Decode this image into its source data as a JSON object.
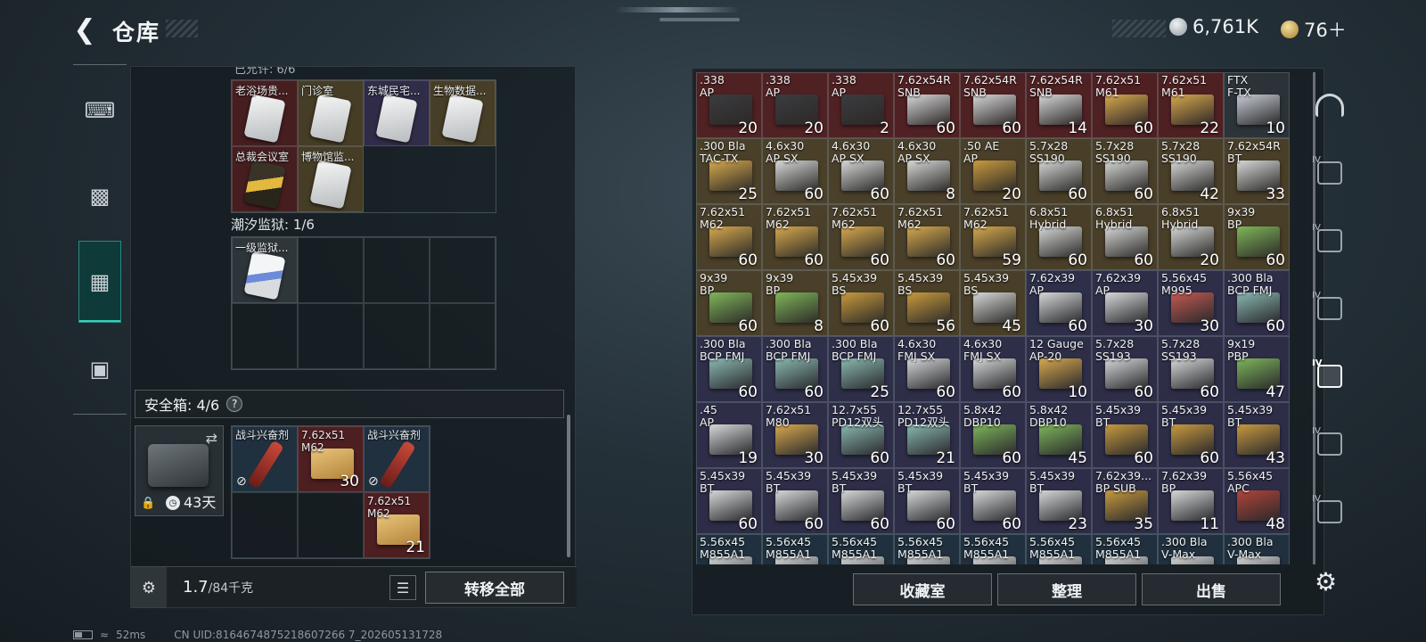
{
  "header": {
    "title": "仓库",
    "silver_amount": "6,761K",
    "gold_amount": "76＋"
  },
  "left_nav": [
    "gun-icon",
    "backpack-icon",
    "container-icon",
    "briefcase-icon"
  ],
  "keycards": {
    "cut_label": "已允许: 6/6",
    "items": [
      {
        "label": "老浴场贵...",
        "rarity": "red",
        "icon": "card-icon"
      },
      {
        "label": "门诊室",
        "rarity": "gold",
        "icon": "card-icon"
      },
      {
        "label": "东城民宅...",
        "rarity": "purple",
        "icon": "card-icon"
      },
      {
        "label": "生物数据...",
        "rarity": "gold",
        "icon": "card-icon"
      },
      {
        "label": "总裁会议室",
        "rarity": "red",
        "icon": "card-icon-gold"
      },
      {
        "label": "博物馆监...",
        "rarity": "gold",
        "icon": "card-icon"
      }
    ],
    "prison_label": "潮汐监狱: 1/6",
    "prison_items": [
      {
        "label": "一级监狱...",
        "rarity": "gray",
        "icon": "card-icon-blue"
      }
    ]
  },
  "safe_box": {
    "label": "安全箱: 4/6",
    "help": "?",
    "days": "43天",
    "items": [
      {
        "label": "战斗兴奋剂",
        "count": "",
        "type": "stim"
      },
      {
        "label": "7.62x51\nM62",
        "count": "30",
        "type": "ammo"
      },
      {
        "label": "战斗兴奋剂",
        "count": "",
        "type": "stim"
      },
      {
        "label": "7.62x51\nM62",
        "count": "21",
        "type": "ammo"
      }
    ]
  },
  "weight": {
    "current": "1.7",
    "max": "/84千克"
  },
  "buttons": {
    "transfer_all": "转移全部",
    "collection": "收藏室",
    "organize": "整理",
    "sell": "出售"
  },
  "right_nav": [
    {
      "tag": "",
      "icon": "arch-icon"
    },
    {
      "tag": "IV",
      "icon": "stash-tab-1-icon"
    },
    {
      "tag": "IV",
      "icon": "stash-tab-2-icon"
    },
    {
      "tag": "IV",
      "icon": "stash-tab-3-icon"
    },
    {
      "tag": "IV",
      "icon": "stash-tab-4-icon",
      "active": true
    },
    {
      "tag": "IV",
      "icon": "stash-tab-5-icon"
    },
    {
      "tag": "IV",
      "icon": "stash-tab-6-icon"
    }
  ],
  "stash": [
    {
      "name": ".338\nAP",
      "count": "20",
      "bg": "red",
      "box": "#3a3d3f"
    },
    {
      "name": ".338\nAP",
      "count": "20",
      "bg": "red",
      "box": "#3a3d3f"
    },
    {
      "name": ".338\nAP",
      "count": "2",
      "bg": "red",
      "box": "#3a3d3f"
    },
    {
      "name": "7.62x54R\nSNB",
      "count": "60",
      "bg": "red",
      "box": "#d6d8d8"
    },
    {
      "name": "7.62x54R\nSNB",
      "count": "60",
      "bg": "red",
      "box": "#d6d8d8"
    },
    {
      "name": "7.62x54R\nSNB",
      "count": "14",
      "bg": "red",
      "box": "#d6d8d8"
    },
    {
      "name": "7.62x51\nM61",
      "count": "60",
      "bg": "red",
      "box": "#d7a94e"
    },
    {
      "name": "7.62x51\nM61",
      "count": "22",
      "bg": "red",
      "box": "#d7a94e"
    },
    {
      "name": "FTX\nF-TX",
      "count": "10",
      "bg": "gray",
      "box": "#c9ccd6"
    },
    {
      "name": ".300 Bla\nTAC-TX",
      "count": "25",
      "bg": "gold",
      "box": "#d7a94e"
    },
    {
      "name": "4.6x30\nAP SX",
      "count": "60",
      "bg": "gold",
      "box": "#d6d8d8"
    },
    {
      "name": "4.6x30\nAP SX",
      "count": "60",
      "bg": "gold",
      "box": "#d6d8d8"
    },
    {
      "name": "4.6x30\nAP SX",
      "count": "8",
      "bg": "gold",
      "box": "#d6d8d8"
    },
    {
      "name": ".50 AE\nAP",
      "count": "20",
      "bg": "gold",
      "box": "#c89a3e"
    },
    {
      "name": "5.7x28\nSS190",
      "count": "60",
      "bg": "gold",
      "box": "#d6d8d8"
    },
    {
      "name": "5.7x28\nSS190",
      "count": "60",
      "bg": "gold",
      "box": "#d6d8d8"
    },
    {
      "name": "5.7x28\nSS190",
      "count": "42",
      "bg": "gold",
      "box": "#d6d8d8"
    },
    {
      "name": "7.62x54R\nBT",
      "count": "33",
      "bg": "gold",
      "box": "#d6d8d8"
    },
    {
      "name": "7.62x51\nM62",
      "count": "60",
      "bg": "gold",
      "box": "#d7a94e"
    },
    {
      "name": "7.62x51\nM62",
      "count": "60",
      "bg": "gold",
      "box": "#d7a94e"
    },
    {
      "name": "7.62x51\nM62",
      "count": "60",
      "bg": "gold",
      "box": "#d7a94e"
    },
    {
      "name": "7.62x51\nM62",
      "count": "60",
      "bg": "gold",
      "box": "#d7a94e"
    },
    {
      "name": "7.62x51\nM62",
      "count": "59",
      "bg": "gold",
      "box": "#d7a94e"
    },
    {
      "name": "6.8x51\nHybrid",
      "count": "60",
      "bg": "gold",
      "box": "#d6d8d8"
    },
    {
      "name": "6.8x51\nHybrid",
      "count": "60",
      "bg": "gold",
      "box": "#d6d8d8"
    },
    {
      "name": "6.8x51\nHybrid",
      "count": "20",
      "bg": "gold",
      "box": "#d6d8d8"
    },
    {
      "name": "9x39\nBP",
      "count": "60",
      "bg": "gold",
      "box": "#7fb65a"
    },
    {
      "name": "9x39\nBP",
      "count": "60",
      "bg": "gold",
      "box": "#7fb65a"
    },
    {
      "name": "9x39\nBP",
      "count": "8",
      "bg": "gold",
      "box": "#7fb65a"
    },
    {
      "name": "5.45x39\nBS",
      "count": "60",
      "bg": "gold",
      "box": "#c89a3e"
    },
    {
      "name": "5.45x39\nBS",
      "count": "56",
      "bg": "gold",
      "box": "#c89a3e"
    },
    {
      "name": "5.45x39\nBS",
      "count": "45",
      "bg": "gold",
      "box": "#d6d8d8"
    },
    {
      "name": "7.62x39\nAP",
      "count": "60",
      "bg": "purple",
      "box": "#d6d8d8"
    },
    {
      "name": "7.62x39\nAP",
      "count": "30",
      "bg": "purple",
      "box": "#d6d8d8"
    },
    {
      "name": "5.56x45\nM995",
      "count": "30",
      "bg": "purple",
      "box": "#c45a50"
    },
    {
      "name": ".300 Bla\nBCP FMJ",
      "count": "60",
      "bg": "purple",
      "box": "#8ab8b0"
    },
    {
      "name": ".300 Bla\nBCP FMJ",
      "count": "60",
      "bg": "purple",
      "box": "#8ab8b0"
    },
    {
      "name": ".300 Bla\nBCP FMJ",
      "count": "60",
      "bg": "purple",
      "box": "#8ab8b0"
    },
    {
      "name": ".300 Bla\nBCP FMJ",
      "count": "25",
      "bg": "purple",
      "box": "#8ab8b0"
    },
    {
      "name": "4.6x30\nFMJ SX",
      "count": "60",
      "bg": "purple",
      "box": "#d6d8d8"
    },
    {
      "name": "4.6x30\nFMJ SX",
      "count": "60",
      "bg": "purple",
      "box": "#d6d8d8"
    },
    {
      "name": "12 Gauge\nAP-20",
      "count": "10",
      "bg": "purple",
      "box": "#d7a94e"
    },
    {
      "name": "5.7x28\nSS193",
      "count": "60",
      "bg": "purple",
      "box": "#d6d8d8"
    },
    {
      "name": "5.7x28\nSS193",
      "count": "60",
      "bg": "purple",
      "box": "#d6d8d8"
    },
    {
      "name": "9x19\nPBP",
      "count": "47",
      "bg": "purple",
      "box": "#7fb65a"
    },
    {
      "name": ".45\nAP",
      "count": "19",
      "bg": "purple",
      "box": "#d6d8d8"
    },
    {
      "name": "7.62x51\nM80",
      "count": "30",
      "bg": "purple",
      "box": "#d7a94e"
    },
    {
      "name": "12.7x55\nPD12双头",
      "count": "60",
      "bg": "purple",
      "box": "#8ab8b0"
    },
    {
      "name": "12.7x55\nPD12双头",
      "count": "21",
      "bg": "purple",
      "box": "#8ab8b0"
    },
    {
      "name": "5.8x42\nDBP10",
      "count": "60",
      "bg": "purple",
      "box": "#7fb65a"
    },
    {
      "name": "5.8x42\nDBP10",
      "count": "45",
      "bg": "purple",
      "box": "#7fb65a"
    },
    {
      "name": "5.45x39\nBT",
      "count": "60",
      "bg": "purple",
      "box": "#c89a3e"
    },
    {
      "name": "5.45x39\nBT",
      "count": "60",
      "bg": "purple",
      "box": "#c89a3e"
    },
    {
      "name": "5.45x39\nBT",
      "count": "43",
      "bg": "purple",
      "box": "#c89a3e"
    },
    {
      "name": "5.45x39\nBT",
      "count": "60",
      "bg": "purple",
      "box": "#d6d8d8"
    },
    {
      "name": "5.45x39\nBT",
      "count": "60",
      "bg": "purple",
      "box": "#d6d8d8"
    },
    {
      "name": "5.45x39\nBT",
      "count": "60",
      "bg": "purple",
      "box": "#d6d8d8"
    },
    {
      "name": "5.45x39\nBT",
      "count": "60",
      "bg": "purple",
      "box": "#d6d8d8"
    },
    {
      "name": "5.45x39\nBT",
      "count": "60",
      "bg": "purple",
      "box": "#d6d8d8"
    },
    {
      "name": "5.45x39\nBT",
      "count": "23",
      "bg": "purple",
      "box": "#d6d8d8"
    },
    {
      "name": "7.62x39...\nBP SUB",
      "count": "35",
      "bg": "purple",
      "box": "#c89a3e"
    },
    {
      "name": "7.62x39\nBP",
      "count": "11",
      "bg": "purple",
      "box": "#d6d8d8"
    },
    {
      "name": "5.56x45\nAPC",
      "count": "48",
      "bg": "purple",
      "box": "#b24438"
    },
    {
      "name": "5.56x45\nM855A1",
      "count": "",
      "bg": "blue",
      "box": "#d6d8d8"
    },
    {
      "name": "5.56x45\nM855A1",
      "count": "",
      "bg": "blue",
      "box": "#d6d8d8"
    },
    {
      "name": "5.56x45\nM855A1",
      "count": "",
      "bg": "blue",
      "box": "#d6d8d8"
    },
    {
      "name": "5.56x45\nM855A1",
      "count": "",
      "bg": "blue",
      "box": "#d6d8d8"
    },
    {
      "name": "5.56x45\nM855A1",
      "count": "",
      "bg": "blue",
      "box": "#d6d8d8"
    },
    {
      "name": "5.56x45\nM855A1",
      "count": "",
      "bg": "blue",
      "box": "#d6d8d8"
    },
    {
      "name": "5.56x45\nM855A1",
      "count": "",
      "bg": "blue",
      "box": "#d6d8d8"
    },
    {
      "name": ".300 Bla\nV-Max",
      "count": "",
      "bg": "blue",
      "box": "#d6d8d8"
    },
    {
      "name": ".300 Bla\nV-Max",
      "count": "",
      "bg": "blue",
      "box": "#d6d8d8"
    }
  ],
  "status": {
    "ping": "52ms",
    "uid": "CN UID:8164674875218607266 7_202605131728"
  }
}
